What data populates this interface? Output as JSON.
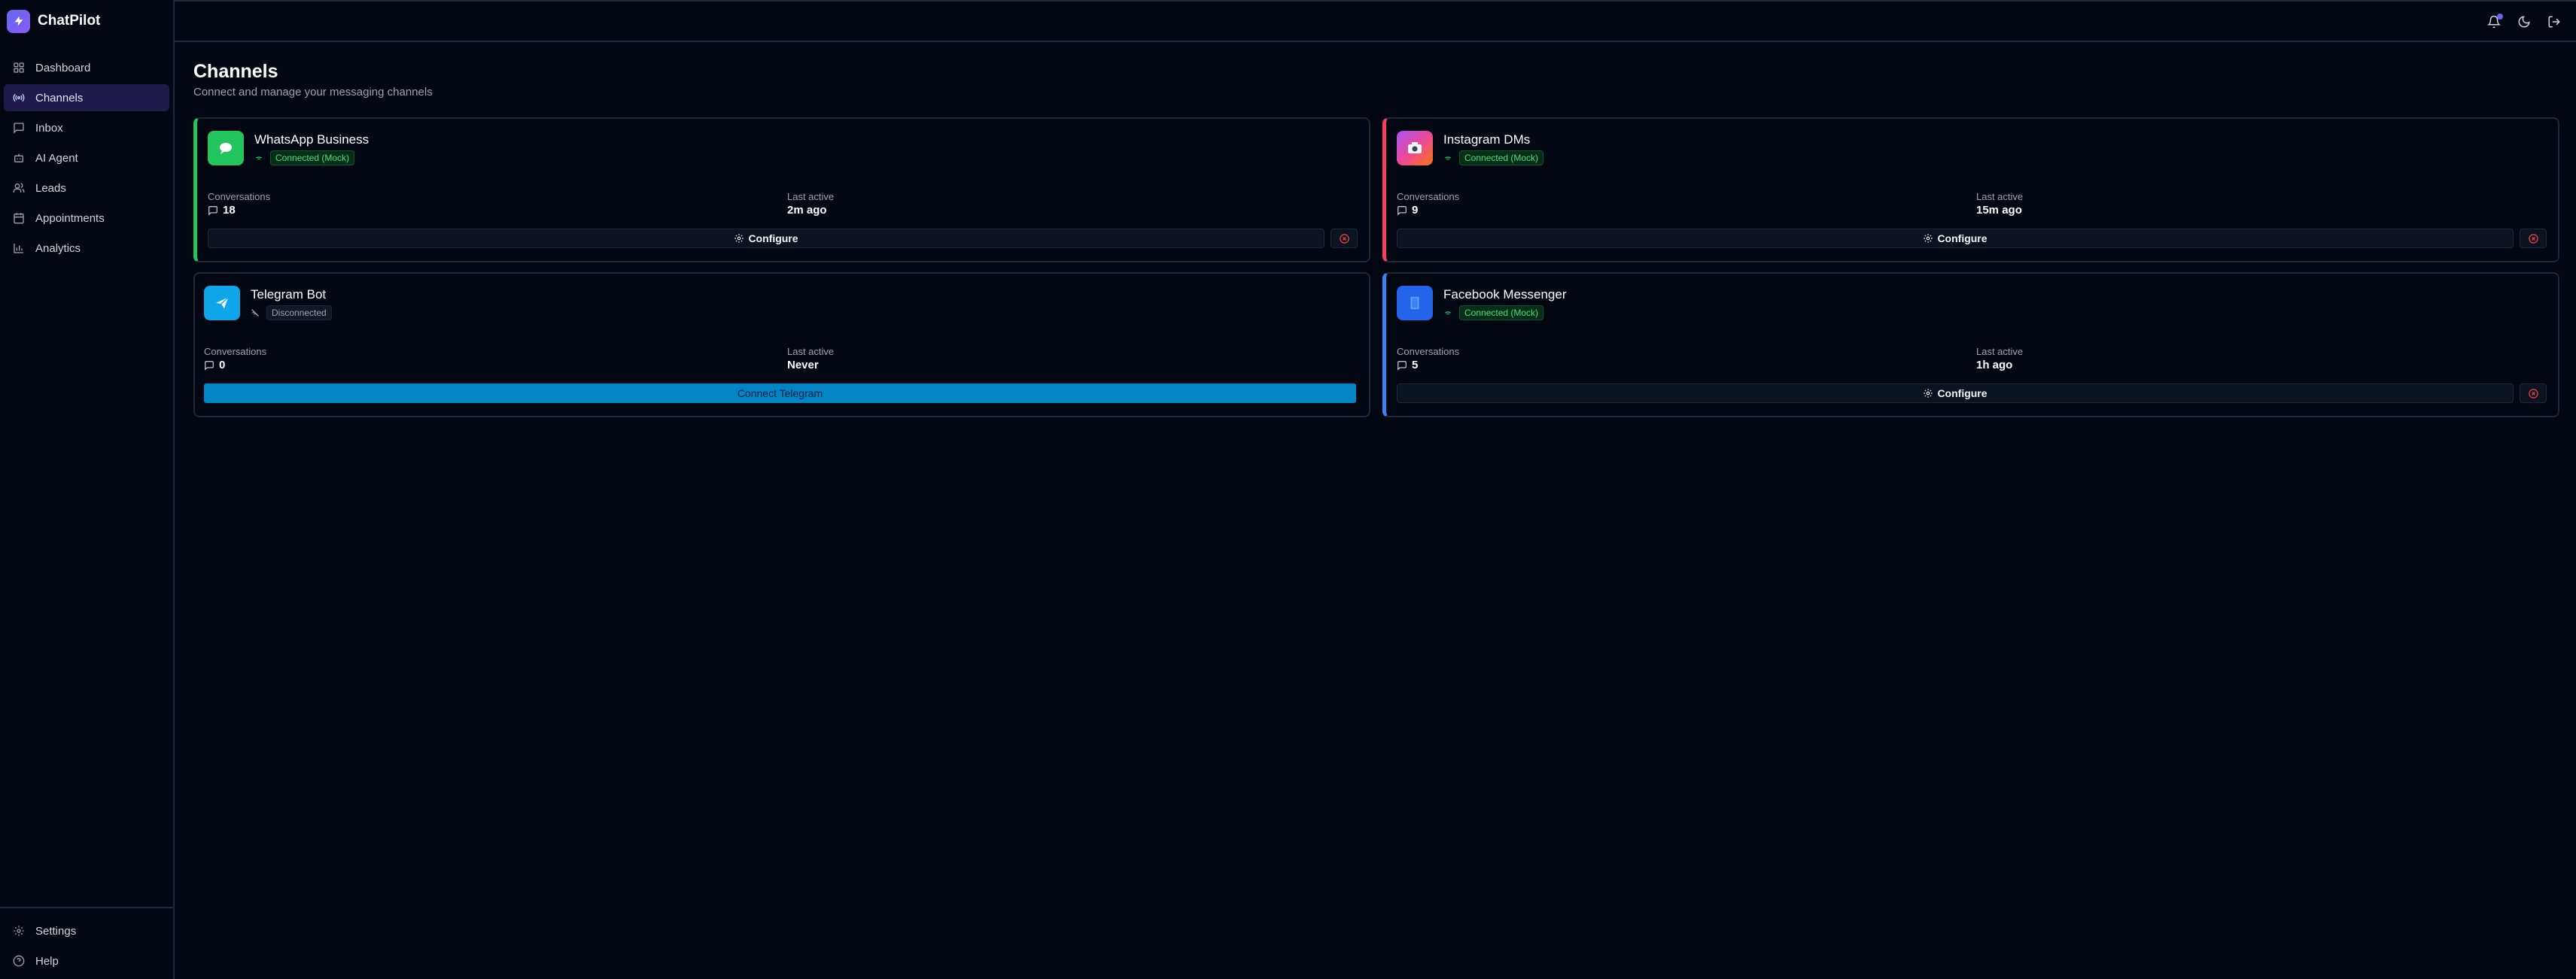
{
  "app": {
    "name": "ChatPilot"
  },
  "sidebar": {
    "items": [
      {
        "label": "Dashboard",
        "icon": "grid-icon",
        "active": false
      },
      {
        "label": "Channels",
        "icon": "radio-icon",
        "active": true
      },
      {
        "label": "Inbox",
        "icon": "message-icon",
        "active": false
      },
      {
        "label": "AI Agent",
        "icon": "bot-icon",
        "active": false
      },
      {
        "label": "Leads",
        "icon": "users-icon",
        "active": false
      },
      {
        "label": "Appointments",
        "icon": "calendar-icon",
        "active": false
      },
      {
        "label": "Analytics",
        "icon": "bar-chart-icon",
        "active": false
      }
    ],
    "bottom": [
      {
        "label": "Settings",
        "icon": "gear-icon"
      },
      {
        "label": "Help",
        "icon": "help-circle-icon"
      }
    ]
  },
  "topbar": {
    "icons": [
      "bell-icon",
      "moon-icon",
      "logout-icon"
    ]
  },
  "page": {
    "title": "Channels",
    "subtitle": "Connect and manage your messaging channels"
  },
  "channels": [
    {
      "name": "WhatsApp Business",
      "status": "Connected (Mock)",
      "conversations_label": "Conversations",
      "conversations": "18",
      "last_active_label": "Last active",
      "last_active": "2m ago",
      "action": "Configure",
      "accent": "#22c55e"
    },
    {
      "name": "Instagram DMs",
      "status": "Connected (Mock)",
      "conversations_label": "Conversations",
      "conversations": "9",
      "last_active_label": "Last active",
      "last_active": "15m ago",
      "action": "Configure",
      "accent": "#f43f5e"
    },
    {
      "name": "Telegram Bot",
      "status": "Disconnected",
      "conversations_label": "Conversations",
      "conversations": "0",
      "last_active_label": "Last active",
      "last_active": "Never",
      "action": "Connect Telegram",
      "accent": null
    },
    {
      "name": "Facebook Messenger",
      "status": "Connected (Mock)",
      "conversations_label": "Conversations",
      "conversations": "5",
      "last_active_label": "Last active",
      "last_active": "1h ago",
      "action": "Configure",
      "accent": "#3b82f6"
    }
  ]
}
